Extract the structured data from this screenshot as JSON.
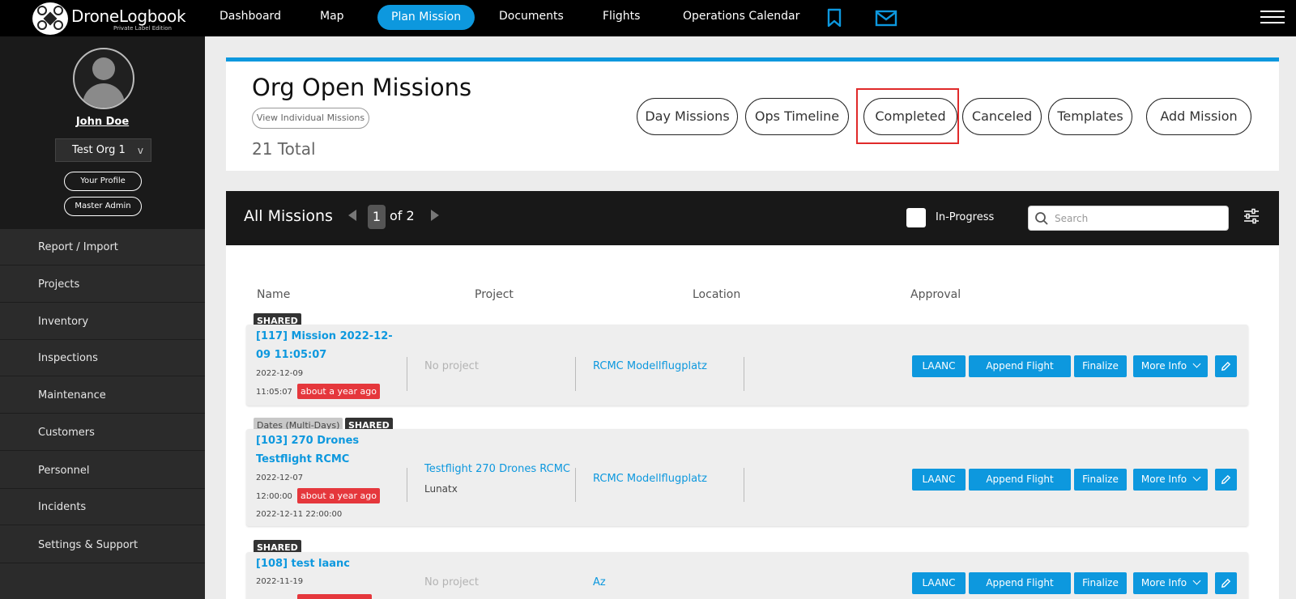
{
  "brand": {
    "name": "DroneLogbook",
    "subtitle": "Private Label Edition"
  },
  "nav": {
    "items": [
      "Dashboard",
      "Map",
      "Plan Mission",
      "Documents",
      "Flights",
      "Operations Calendar"
    ],
    "active": "Plan Mission"
  },
  "user": {
    "name": "John Doe",
    "org": "Test Org 1",
    "org_chevron": "v",
    "profile_label": "Your Profile",
    "admin_label": "Master Admin"
  },
  "sidebar": {
    "items": [
      "Report / Import",
      "Projects",
      "Inventory",
      "Inspections",
      "Maintenance",
      "Customers",
      "Personnel",
      "Incidents",
      "Settings & Support"
    ]
  },
  "header": {
    "title": "Org Open Missions",
    "view_individual": "View Individual Missions",
    "total": "21 Total",
    "buttons": [
      "Day Missions",
      "Ops Timeline",
      "Completed",
      "Canceled",
      "Templates",
      "Add Mission"
    ]
  },
  "missions": {
    "title": "All Missions",
    "page_current": "1",
    "page_of": "of 2",
    "in_progress_label": "In-Progress",
    "search_placeholder": "Search",
    "columns": [
      "Name",
      "Project",
      "Location",
      "Approval"
    ],
    "actions": {
      "laanc": "LAANC",
      "append": "Append Flight",
      "finalize": "Finalize",
      "more": "More Info"
    },
    "rows": [
      {
        "tags": [
          "SHARED"
        ],
        "name": "[117] Mission 2022-12-09 11:05:07",
        "date": "2022-12-09",
        "time": "11:05:07",
        "ago": "about a year ago",
        "project": "No project",
        "location": "RCMC Modellflugplatz"
      },
      {
        "tags": [
          "Dates (Multi-Days)",
          "SHARED"
        ],
        "name": "[103] 270 Drones Testflight RCMC",
        "date": "2022-12-07",
        "time": "12:00:00",
        "ago": "about a year ago",
        "end": "2022-12-11 22:00:00",
        "project": "Testflight 270 Drones RCMC",
        "project_sub": "Lunatx",
        "location": "RCMC Modellflugplatz"
      },
      {
        "tags": [
          "SHARED"
        ],
        "name": "[108] test laanc",
        "date": "2022-11-19",
        "project": "No project",
        "location": "Az"
      }
    ]
  },
  "colors": {
    "accent": "#0d98de",
    "alert": "#e5373c",
    "highlight": "#e02a2a"
  }
}
